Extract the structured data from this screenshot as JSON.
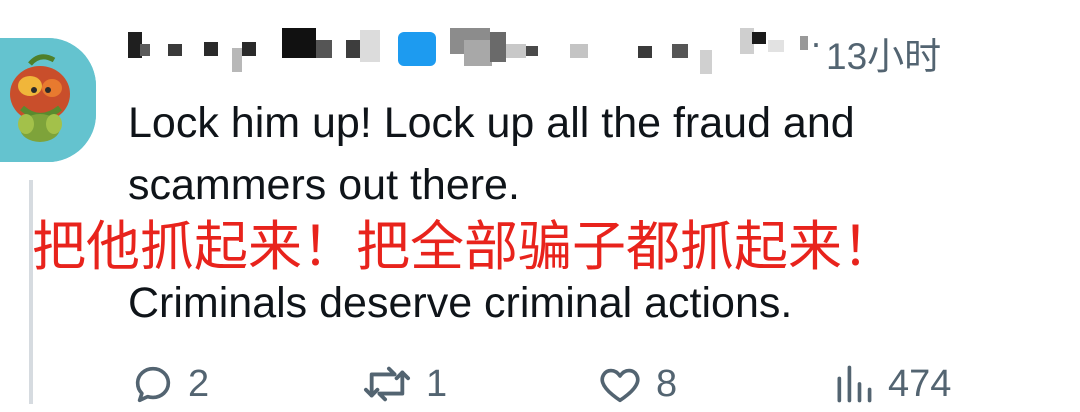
{
  "tweet": {
    "author_redacted": true,
    "separator": "·",
    "timestamp": "13小时",
    "text_line1": "Lock him up! Lock up all the fraud and",
    "text_line2": "scammers out there.",
    "translation": "把他抓起来！把全部骗子都抓起来！",
    "text_line3": "Criminals deserve criminal actions."
  },
  "actions": {
    "reply": {
      "icon": "reply-icon",
      "count": "2"
    },
    "retweet": {
      "icon": "retweet-icon",
      "count": "1"
    },
    "like": {
      "icon": "heart-icon",
      "count": "8"
    },
    "views": {
      "icon": "views-icon",
      "count": "474"
    }
  },
  "colors": {
    "text": "#0f1419",
    "muted": "#536471",
    "translation": "#e8231c",
    "avatar_bg": "#64c3cf",
    "verified": "#1d9bf0"
  }
}
